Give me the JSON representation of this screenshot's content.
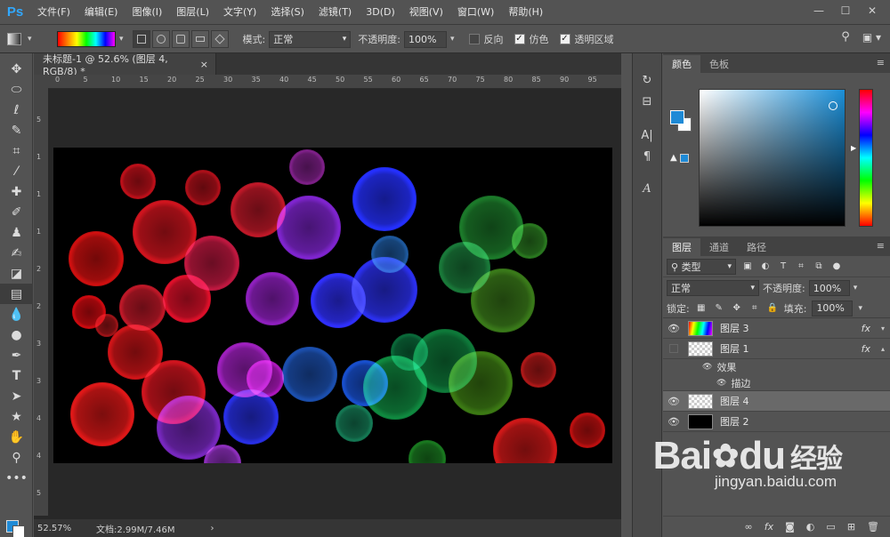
{
  "app": {
    "logo": "Ps"
  },
  "menubar": {
    "items": [
      "文件(F)",
      "编辑(E)",
      "图像(I)",
      "图层(L)",
      "文字(Y)",
      "选择(S)",
      "滤镜(T)",
      "3D(D)",
      "视图(V)",
      "窗口(W)",
      "帮助(H)"
    ]
  },
  "window_controls": {
    "minimize": "—",
    "maximize": "☐",
    "close": "✕"
  },
  "options": {
    "mode_label": "模式:",
    "mode_value": "正常",
    "opacity_label": "不透明度:",
    "opacity_value": "100%",
    "reverse_label": "反向",
    "reverse_checked": false,
    "dither_label": "仿色",
    "dither_checked": true,
    "transparency_label": "透明区域",
    "transparency_checked": true
  },
  "document": {
    "tab_title": "未标题-1 @ 52.6% (图层 4, RGB/8) *",
    "tab_close": "×",
    "ruler_h": [
      "0",
      "5",
      "10",
      "15",
      "20",
      "25",
      "30",
      "35",
      "40",
      "45",
      "50",
      "55",
      "60",
      "65",
      "70",
      "75",
      "80",
      "85",
      "90",
      "95"
    ],
    "ruler_v": [
      "5",
      "1",
      "1",
      "1",
      "2",
      "2",
      "3",
      "3",
      "4",
      "4",
      "5"
    ]
  },
  "status": {
    "zoom": "52.57%",
    "doc_info": "文档:2.99M/7.46M",
    "arrow": "›"
  },
  "icon_strip": {
    "items": [
      "history-icon",
      "properties-icon",
      "character-icon",
      "paragraph-icon",
      "glyphs-icon"
    ]
  },
  "color_panel": {
    "tabs": [
      "颜色",
      "色板"
    ],
    "fg_color": "#1e8ad6",
    "bg_color": "#ffffff"
  },
  "layers_panel": {
    "tabs": [
      "图层",
      "通道",
      "路径"
    ],
    "filter_label": "类型",
    "blend_mode": "正常",
    "opacity_label": "不透明度:",
    "opacity_value": "100%",
    "lock_label": "锁定:",
    "fill_label": "填充:",
    "fill_value": "100%",
    "layers": [
      {
        "name": "图层 3",
        "visible": true,
        "fx": "fx",
        "thumb": "grad",
        "selected": false
      },
      {
        "name": "图层 1",
        "visible": false,
        "fx": "fx",
        "thumb": "checker",
        "selected": false
      },
      {
        "name": "图层 4",
        "visible": true,
        "fx": "",
        "thumb": "checker",
        "selected": true
      },
      {
        "name": "图层 2",
        "visible": true,
        "fx": "",
        "thumb": "black",
        "selected": false
      }
    ],
    "effects_label": "效果",
    "stroke_label": "描边",
    "bottom_icons": [
      "link-icon",
      "fx-icon",
      "mask-icon",
      "adjustment-icon",
      "group-icon",
      "new-layer-icon",
      "delete-icon"
    ]
  },
  "watermark": {
    "text": "Bai",
    "du": "du",
    "cn": "经验",
    "url": "jingyan.baidu.com"
  }
}
